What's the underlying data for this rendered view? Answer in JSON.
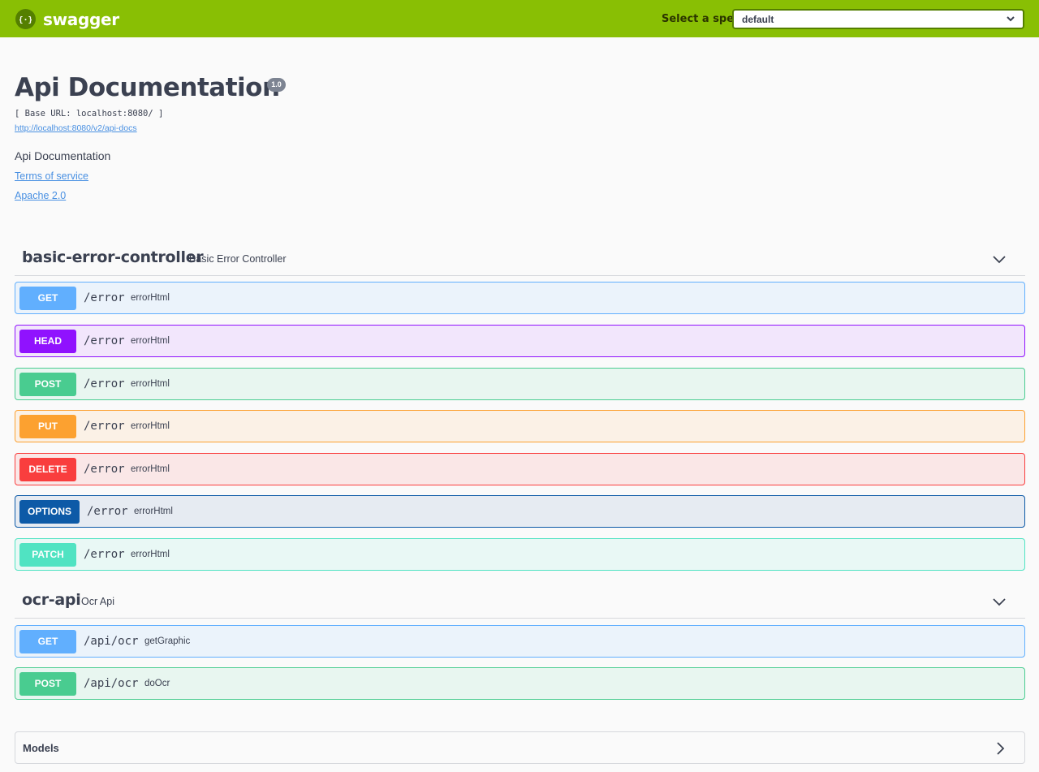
{
  "topbar": {
    "logo_text": "swagger",
    "spec_label": "Select a spec",
    "spec_value": "default",
    "bg_color": "#89bf04"
  },
  "info": {
    "title": "Api Documentation",
    "version": "1.0",
    "base_url": "[ Base URL: localhost:8080/ ]",
    "api_docs_url": "http://localhost:8080/v2/api-docs",
    "description": "Api Documentation",
    "terms_of_service": "Terms of service",
    "license": "Apache 2.0"
  },
  "tags": [
    {
      "name": "basic-error-controller",
      "description": "Basic Error Controller",
      "operations": [
        {
          "method": "GET",
          "path": "/error",
          "summary": "errorHtml"
        },
        {
          "method": "HEAD",
          "path": "/error",
          "summary": "errorHtml"
        },
        {
          "method": "POST",
          "path": "/error",
          "summary": "errorHtml"
        },
        {
          "method": "PUT",
          "path": "/error",
          "summary": "errorHtml"
        },
        {
          "method": "DELETE",
          "path": "/error",
          "summary": "errorHtml"
        },
        {
          "method": "OPTIONS",
          "path": "/error",
          "summary": "errorHtml"
        },
        {
          "method": "PATCH",
          "path": "/error",
          "summary": "errorHtml"
        }
      ]
    },
    {
      "name": "ocr-api",
      "description": "Ocr Api",
      "operations": [
        {
          "method": "GET",
          "path": "/api/ocr",
          "summary": "getGraphic"
        },
        {
          "method": "POST",
          "path": "/api/ocr",
          "summary": "doOcr"
        }
      ]
    }
  ],
  "models": {
    "label": "Models"
  },
  "method_colors": {
    "GET": "#61affe",
    "HEAD": "#9012fe",
    "POST": "#49cc90",
    "PUT": "#fca130",
    "DELETE": "#f93e3e",
    "OPTIONS": "#0d5aa7",
    "PATCH": "#50e3c2"
  },
  "icons": {
    "logo": "swagger-logo-icon",
    "select_arrow": "chevron-down-icon",
    "tag_toggle": "chevron-down-icon",
    "models_toggle": "chevron-right-icon"
  }
}
